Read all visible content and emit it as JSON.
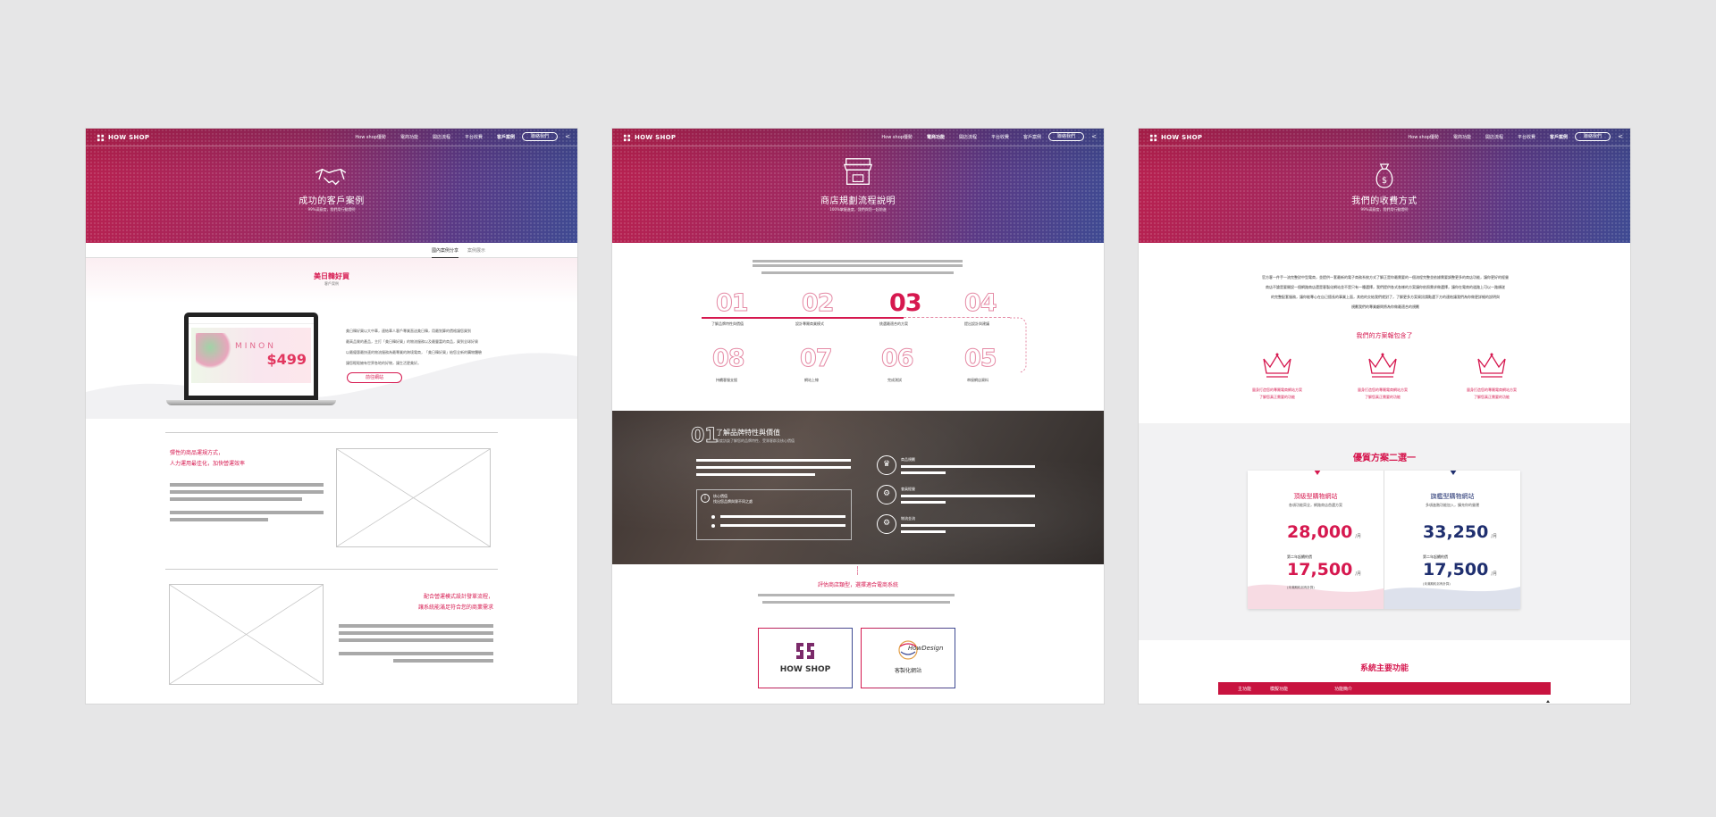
{
  "nav": {
    "brand": "HOW SHOP",
    "items": [
      "How shop優勢",
      "電商功能",
      "開店流程",
      "平台收費",
      "客戶案例"
    ],
    "cta": "聯絡我們",
    "share_icon": "share-icon"
  },
  "panel1": {
    "hero_title": "成功的客戶案例",
    "hero_sub": "99%滿意度，我們用行動證明",
    "tabs": [
      "國內案例分享",
      "案例展示"
    ],
    "case_title": "美日韓好買",
    "case_sub": "客戶案例",
    "case_desc": [
      "美日韓好買以大中華，連結華人客戶專業直送美日韓，用最划算的價格讓您買到",
      "最高品質的產品，主打「美日韓好買」的物流服務以及最豐富的商品，買到全球好貨",
      "以最優惠最快速的物流服務為最專業的跨境電商，「美日韓好買」給您全新的購物體驗",
      "讓您輕鬆擁有世界各地的好物，讓生活更美好。"
    ],
    "case_button": "前往網站",
    "screen_price": "$499",
    "screen_brand": "MINON",
    "sec1_title": [
      "彈性的商品運規方式，",
      "人力運用最佳化，加快營運效率"
    ],
    "sec2_title": [
      "配合營運模式設計發單流程，",
      "讓系統能滿足符合您的商業需求"
    ]
  },
  "panel2": {
    "hero_title": "商店規劃流程說明",
    "hero_sub": "100%掌握進度，我們與您一起前進",
    "steps": [
      {
        "num": "01",
        "label": "了解品牌特性與價值"
      },
      {
        "num": "02",
        "label": "設計專屬商業模式"
      },
      {
        "num": "03",
        "label": "挑選最適合的方案"
      },
      {
        "num": "04",
        "label": "提出設計與建議"
      },
      {
        "num": "08",
        "label": "持續客服支援"
      },
      {
        "num": "07",
        "label": "網站上線"
      },
      {
        "num": "06",
        "label": "完成測試"
      },
      {
        "num": "05",
        "label": "串接網店資料"
      }
    ],
    "detail_num": "01",
    "detail_title": "了解品牌特性與價值",
    "detail_sub": "深度訪談了解您的品牌特性、受眾客群及核心價值",
    "detail_box_line1": "核心價值",
    "detail_box_line2": "找出您品牌與眾不同之處",
    "features": [
      "商品規劃",
      "會員經營",
      "物流金流"
    ],
    "evaluate": "評估商店類型，選擇適合電商系統",
    "logo1": "HOW SHOP",
    "logo2_name": "HowDesign",
    "logo2_caption": "客製化網站"
  },
  "panel3": {
    "hero_title": "我們的收費方式",
    "hero_sub": "99%滿意度，我們用行動證明",
    "intro": [
      "官方客一件手一流完整對中型電商，並提供一套最新的電子商務系統方式了解正是你最需要的一個流程完整並依據需要調整更多的商店功能，讓你更好的經營",
      "商店不論是要開設一個網路商店還是客製化網站並不是只有一種選擇，我們提供各式各樣的方案讓你依照需求做選擇，讓你在電商的道路上可以一路順遂",
      "的完整配套服務，讓你能專心在自己擅長的事業上面，其他的交給我們就對了，了解更多方案資訊請點選下方的連結讓我們為你做更詳細的說明與",
      "規劃我們的專業顧問將為你做最適合的規劃"
    ],
    "plan_includes": "我們的方案報包含了",
    "crowns": [
      {
        "line1": "量身打造您的專屬電商網站方案",
        "line2": "了解您真正需要的功能"
      },
      {
        "line1": "量身打造您的專屬電商網站方案",
        "line2": "了解您真正需要的功能"
      },
      {
        "line1": "量身打造您的專屬電商網站方案",
        "line2": "了解您真正需要的功能"
      }
    ],
    "plans_title": "優質方案二選一",
    "plans": [
      {
        "name": "頂級型購物網站",
        "desc": "各項功能齊全，網路商店首選方案",
        "price": "28,000",
        "unit": "/月",
        "renew_label": "第二年起續約價",
        "renew": "17,500",
        "renew_unit": "/月",
        "note": "(未滿期約另有計算)",
        "color": "#d6184f"
      },
      {
        "name": "旗艦型購物網站",
        "desc": "多項進階功能加入，擴充你的營運",
        "price": "33,250",
        "unit": "/月",
        "renew_label": "第二年起續約價",
        "renew": "17,500",
        "renew_unit": "/月",
        "note": "(未滿期約另有計算)",
        "color": "#1f2f6f"
      }
    ],
    "features_title": "系統主要功能",
    "table_headers": [
      "主功能",
      "模擬功能",
      "功能簡介"
    ]
  },
  "colors": {
    "accent": "#d6184f",
    "navy": "#1f2f6f",
    "bg": "#e6e6e7"
  }
}
